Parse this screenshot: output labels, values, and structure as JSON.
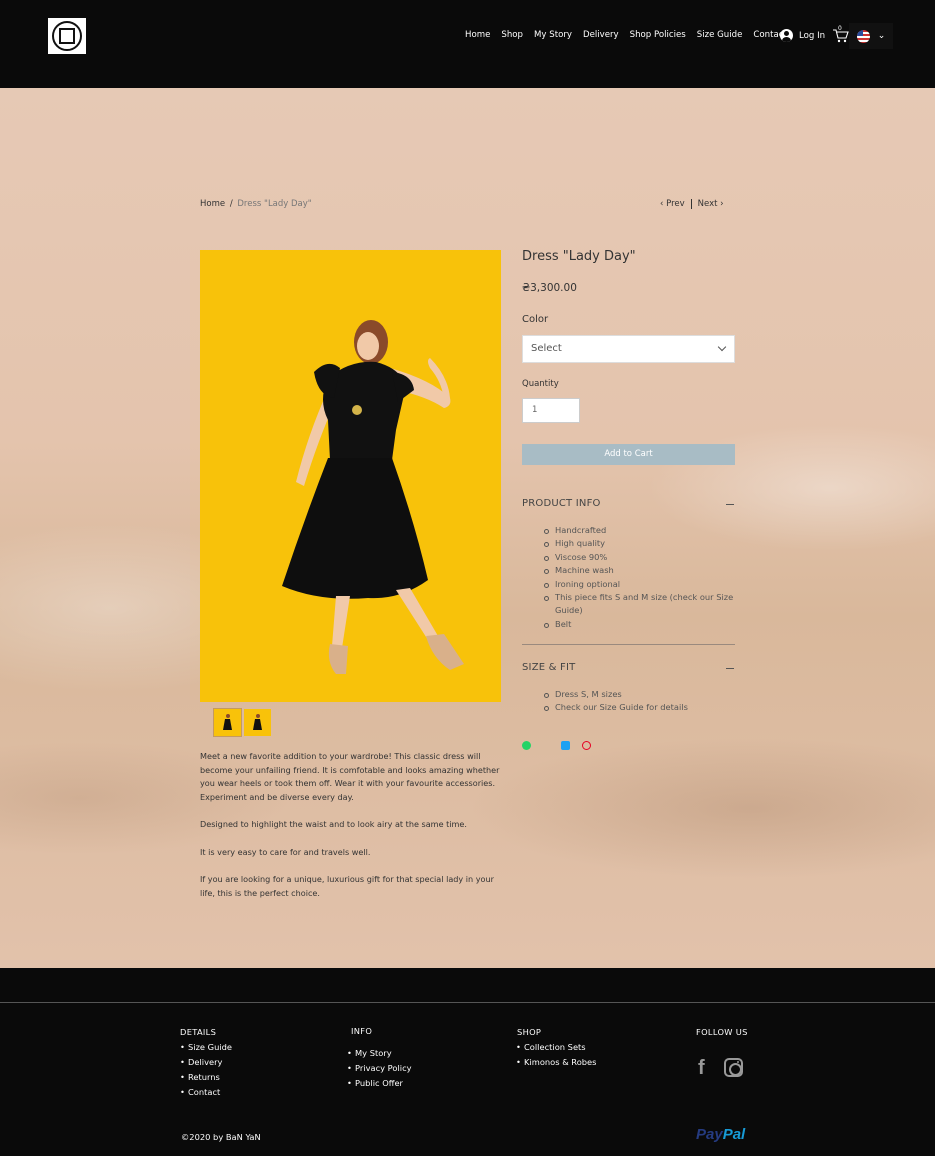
{
  "header": {
    "nav": [
      "Home",
      "Shop",
      "My Story",
      "Delivery",
      "Shop Policies",
      "Size Guide",
      "Contact"
    ],
    "login_label": "Log In",
    "cart_count": "0"
  },
  "breadcrumb": {
    "home": "Home",
    "separator": "/",
    "current": "Dress \"Lady Day\""
  },
  "pager": {
    "prev": "Prev",
    "next": "Next"
  },
  "product": {
    "title": "Dress \"Lady Day\"",
    "price": "₴3,300.00",
    "color_label": "Color",
    "color_select": "Select",
    "quantity_label": "Quantity",
    "quantity_value": "1",
    "add_to_cart": "Add to Cart",
    "description": [
      "Meet a new favorite addition to your wardrobe! This classic dress will become your unfailing friend. It is comfotable and looks amazing whether you wear heels or took them off. Wear it with your favourite accessories. Experiment and be diverse every day.",
      "Designed to highlight the waist and to look airy at the same time.",
      "It is very easy to care for and travels well.",
      "If you are looking for a unique, luxurious gift for that special lady in your life, this is the perfect choice."
    ],
    "info_title": "PRODUCT INFO",
    "info_items": [
      "Handcrafted",
      "High quality",
      "Viscose 90%",
      "Machine wash",
      "Ironing optional",
      "This piece fits S and M size (check our Size Guide)",
      "Belt"
    ],
    "size_title": "SIZE & FIT",
    "size_items": [
      "Dress S, M sizes",
      "Check our Size Guide for details"
    ]
  },
  "footer": {
    "details_title": "DETAILS",
    "details_items": [
      "Size Guide",
      "Delivery",
      "Returns",
      "Contact"
    ],
    "info_title": "INFO",
    "info_items": [
      "My Story",
      "Privacy Policy",
      "Public Offer"
    ],
    "shop_title": "SHOP",
    "shop_items": [
      "Collection Sets",
      "Kimonos & Robes"
    ],
    "follow_title": "FOLLOW US",
    "facebook_glyph": "f",
    "copyright": "©2020 by BaN YaN",
    "paypal_1": "Pay",
    "paypal_2": "Pal"
  },
  "colors": {
    "yellow_bg": "#f8c20a",
    "add_to_cart_bg": "#a8bcc5"
  }
}
